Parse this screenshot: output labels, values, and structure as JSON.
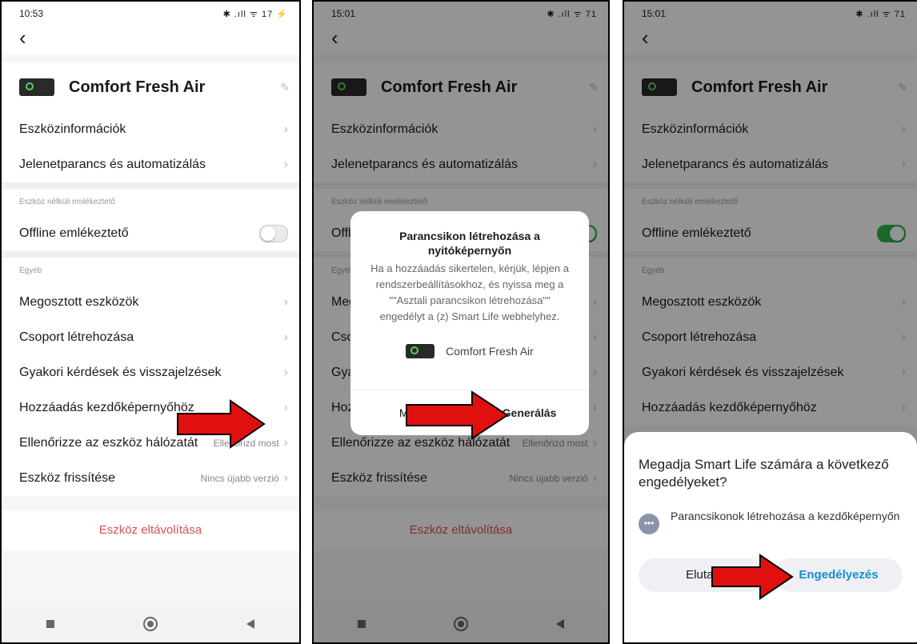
{
  "phone1": {
    "time": "10:53",
    "status_right": "✱ .ıll ᯤ 17 ⚡",
    "battery": "17"
  },
  "phone2": {
    "time": "15:01",
    "status_right": "✱ .ıll ᯤ 71"
  },
  "phone3": {
    "time": "15:01",
    "status_right": "✱ .ıll ᯤ 71"
  },
  "back_icon": "‹",
  "device": {
    "name": "Comfort  Fresh Air",
    "edit_icon": "✎"
  },
  "menu": {
    "info": "Eszközinformációk",
    "scene": "Jelenetparancs és automatizálás",
    "offline_section": "Eszköz nélküli emlékeztető",
    "offline_reminder": "Offline emlékeztető",
    "other_section": "Egyéb",
    "shared": "Megosztott eszközök",
    "group": "Csoport létrehozása",
    "faq": "Gyakori kérdések és visszajelzések",
    "add_home": "Hozzáadás kezdőképernyőhöz",
    "network_check": "Ellenőrizze az eszköz hálózatát",
    "network_check_value": "Ellenőrizd most",
    "update": "Eszköz frissítése",
    "update_value": "Nincs újabb verzió",
    "remove": "Eszköz eltávolítása"
  },
  "dialog": {
    "title": "Parancsikon létrehozása a nyitóképernyőn",
    "body": "Ha a hozzáadás sikertelen, kérjük, lépjen a rendszerbeállításokhoz, és nyissa meg a \"\"Asztali parancsikon létrehozása\"\" engedélyt a (z) Smart Life webhelyhez.",
    "device_name": "Comfort  Fresh Air",
    "cancel": "Még",
    "generate": "Generálás"
  },
  "sheet": {
    "question": "Megadja Smart Life számára a következő engedélyeket?",
    "permission": "Parancsikonok létrehozása a kezdőképernyőn",
    "deny": "Elutas",
    "allow": "Engedélyezés"
  },
  "toggles": {
    "phone1_offline_on": false,
    "phone2_offline_on": true,
    "phone3_offline_on": true
  },
  "colors": {
    "arrow": "#e01010",
    "accent_green": "#2fb451",
    "remove_red": "#d9534f",
    "allow_blue": "#1a8bd6"
  }
}
